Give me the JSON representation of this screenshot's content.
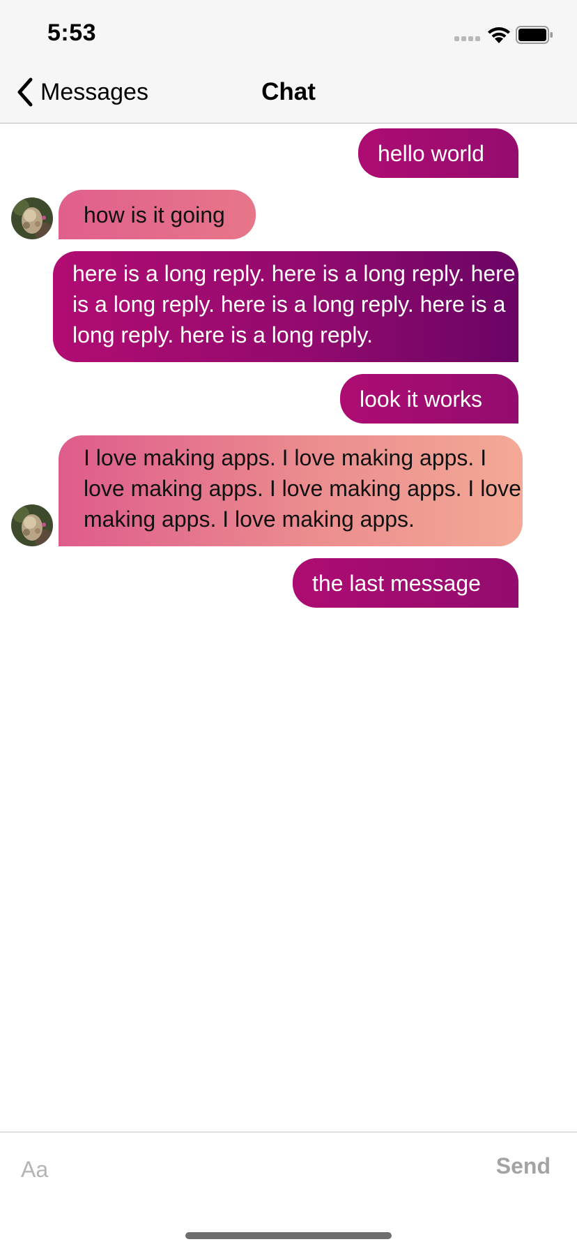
{
  "status_bar": {
    "time": "5:53",
    "icons": [
      "signal-icon",
      "wifi-icon",
      "battery-icon"
    ]
  },
  "nav": {
    "back_icon": "chevron-left-icon",
    "back_label": "Messages",
    "title": "Chat"
  },
  "messages": [
    {
      "direction": "sent",
      "text": "hello world"
    },
    {
      "direction": "received",
      "text": "how is it going",
      "avatar": "avatar"
    },
    {
      "direction": "sent",
      "text": "here is a long reply. here is a long reply. here is a long reply. here is a long reply. here is a long reply. here is a long reply."
    },
    {
      "direction": "sent",
      "text": "look it works"
    },
    {
      "direction": "received",
      "text": "I love making apps. I love making apps. I love making apps. I love making apps. I love making apps. I love making apps.",
      "avatar": "avatar"
    },
    {
      "direction": "sent",
      "text": "the last message"
    }
  ],
  "input": {
    "placeholder": "Aa",
    "value": "",
    "send_label": "Send"
  },
  "colors": {
    "sent_gradient_start": "#ad0c72",
    "sent_gradient_end": "#6a0465",
    "received_gradient_start": "#de5c8c",
    "received_gradient_end": "#f4a996",
    "bar_background": "#f6f6f6",
    "send_disabled": "#a3a3a3"
  }
}
